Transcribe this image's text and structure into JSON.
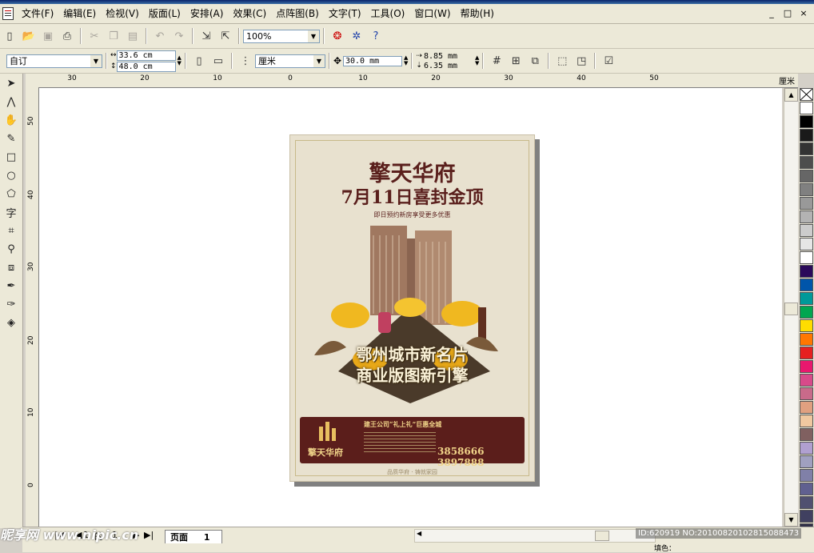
{
  "menubar": {
    "items": [
      "文件(F)",
      "编辑(E)",
      "检视(V)",
      "版面(L)",
      "安排(A)",
      "效果(C)",
      "点阵图(B)",
      "文字(T)",
      "工具(O)",
      "窗口(W)",
      "帮助(H)"
    ],
    "window_buttons": [
      "_",
      "□",
      "×"
    ]
  },
  "toolbar1": {
    "zoom": "100%",
    "icons": [
      "new-icon",
      "open-icon",
      "save-icon",
      "print-icon",
      "cut-icon",
      "copy-icon",
      "paste-icon",
      "undo-icon",
      "redo-icon",
      "import-icon",
      "export-icon",
      "corel-logo-icon",
      "application-launcher-icon",
      "whats-this-icon"
    ]
  },
  "toolbar2": {
    "paper_preset": "自订",
    "width": "33.6 cm",
    "height": "48.0 cm",
    "units": "厘米",
    "nudge": "30.0 mm",
    "dup_x": "8.85 mm",
    "dup_y": "6.35 mm"
  },
  "ruler": {
    "unit": "厘米",
    "h_numbers": [
      "30",
      "20",
      "10",
      "0",
      "10",
      "20",
      "30",
      "40",
      "50"
    ],
    "v_numbers": [
      "50",
      "40",
      "30",
      "20",
      "10",
      "0"
    ]
  },
  "poster": {
    "title": "擎天华府",
    "subtitle": "7月11日喜封金顶",
    "tagline": "即日预约新房享受更多优惠",
    "slogan1": "鄂州城市新名片",
    "slogan2": "商业版图新引擎",
    "banner_heading": "建王公司“礼上礼”巨惠全城",
    "logo_text": "擎天华府",
    "phone": "3858666 3897888",
    "footer": "品质华府 · 铸就家园"
  },
  "page_tabs": {
    "current": "1",
    "of_label": "的",
    "total": "1",
    "tab_label": "页面",
    "tab_number": "1"
  },
  "status": {
    "fill_label": "填色："
  },
  "watermark": {
    "left": "昵享网 www.nipic.cn",
    "right": "ID:620919 NO:20100820102815088473"
  },
  "palette_colors": [
    "#ffffff",
    "#000000",
    "#1a1a1a",
    "#333333",
    "#4d4d4d",
    "#666666",
    "#808080",
    "#999999",
    "#b3b3b3",
    "#cccccc",
    "#e6e6e6",
    "#ffffff",
    "#2a0a5a",
    "#0055aa",
    "#009999",
    "#00a650",
    "#ffdd00",
    "#ff7700",
    "#e62020",
    "#e8186e",
    "#d84a8a",
    "#c86a8a",
    "#e0a080",
    "#f0c8a0",
    "#806060",
    "#b0a0d0",
    "#a0a0c0",
    "#8080a8",
    "#606090",
    "#505070",
    "#404060",
    "#303048"
  ]
}
